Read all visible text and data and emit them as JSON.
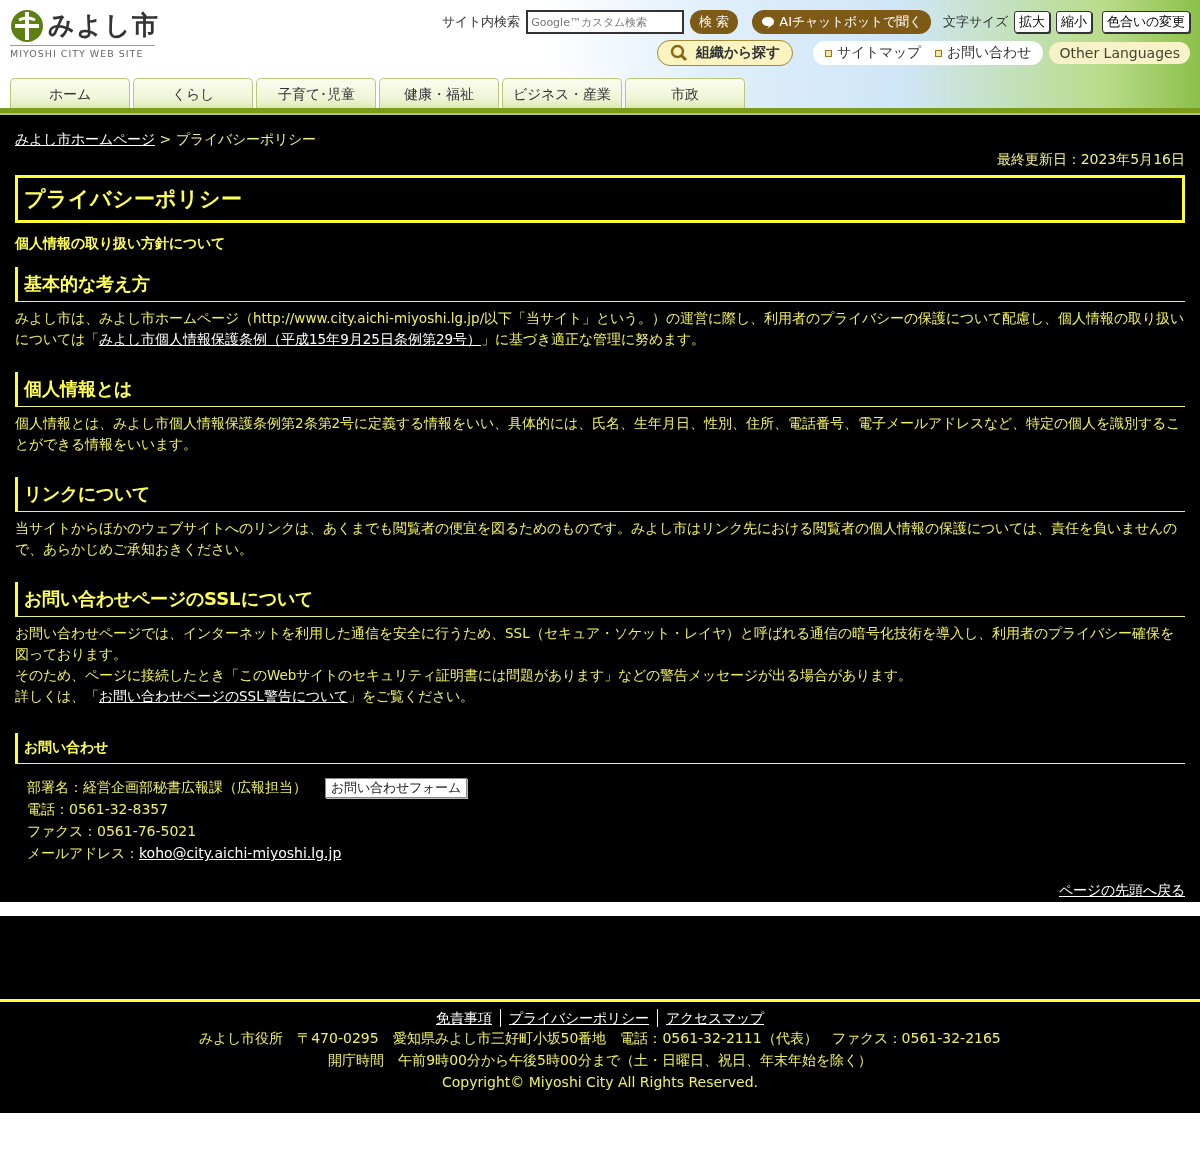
{
  "header": {
    "logo_text": "みよし市",
    "logo_subtext": "MIYOSHI CITY WEB SITE",
    "search_label": "サイト内検索",
    "search": {
      "placeholder": "Google™カスタム検索"
    },
    "search_button": "検 索",
    "chatbot_button": "AIチャットボットで聞く",
    "font_size_label": "文字サイズ",
    "font_buttons": [
      "拡大",
      "縮小"
    ],
    "color_button": "色合いの変更",
    "org_search_button": "組織から探す",
    "links": [
      "サイトマップ",
      "お問い合わせ"
    ],
    "languages_button": "Other Languages"
  },
  "nav_tabs": [
    "ホーム",
    "くらし",
    "子育て･児童",
    "健康・福祉",
    "ビジネス・産業",
    "市政"
  ],
  "breadcrumb": {
    "home": "みよし市ホームページ",
    "separator": ">",
    "current": "プライバシーポリシー"
  },
  "updated": "最終更新日：2023年5月16日",
  "title": "プライバシーポリシー",
  "subtitle": "個人情報の取り扱い方針について",
  "sections": [
    {
      "heading": "基本的な考え方",
      "lines": [
        [
          {
            "kind": "text",
            "text": "みよし市は、みよし市ホームページ（http://www.city.aichi-miyoshi.lg.jp/以下「当サイト」という。）の運営に際し、利用者のプライバシーの保護について配慮し、個人情報の取り扱いについては「"
          },
          {
            "kind": "link",
            "text": "みよし市個人情報保護条例（平成15年9月25日条例第29号）"
          },
          {
            "kind": "text",
            "text": "」に基づき適正な管理に努めます。"
          }
        ]
      ]
    },
    {
      "heading": "個人情報とは",
      "lines": [
        [
          {
            "kind": "text",
            "text": "個人情報とは、みよし市個人情報保護条例第2条第2号に定義する情報をいい、具体的には、氏名、生年月日、性別、住所、電話番号、電子メールアドレスなど、特定の個人を識別することができる情報をいいます。"
          }
        ]
      ]
    },
    {
      "heading": "リンクについて",
      "lines": [
        [
          {
            "kind": "text",
            "text": "当サイトからほかのウェブサイトへのリンクは、あくまでも閲覧者の便宜を図るためのものです。みよし市はリンク先における閲覧者の個人情報の保護については、責任を負いませんので、あらかじめご承知おきください。"
          }
        ]
      ]
    },
    {
      "heading": "お問い合わせページのSSLについて",
      "lines": [
        [
          {
            "kind": "text",
            "text": "お問い合わせページでは、インターネットを利用した通信を安全に行うため、SSL（セキュア・ソケット・レイヤ）と呼ばれる通信の暗号化技術を導入し、利用者のプライバシー確保を図っております。"
          }
        ],
        [
          {
            "kind": "text",
            "text": "そのため、ページに接続したとき「このWebサイトのセキュリティ証明書には問題があります」などの警告メッセージが出る場合があります。"
          }
        ],
        [
          {
            "kind": "text",
            "text": "詳しくは、「"
          },
          {
            "kind": "link",
            "text": "お問い合わせページのSSL警告について"
          },
          {
            "kind": "text",
            "text": "」をご覧ください。"
          }
        ]
      ]
    }
  ],
  "contact": {
    "heading": "お問い合わせ",
    "department": "部署名：経営企画部秘書広報課（広報担当）",
    "form_button": "お問い合わせフォーム",
    "phone": "電話：0561-32-8357",
    "fax": "ファクス：0561-76-5021",
    "email_label": "メールアドレス：",
    "email": "koho@city.aichi-miyoshi.lg.jp"
  },
  "back_to_top": "ページの先頭へ戻る",
  "footer": {
    "links": [
      "免責事項",
      "プライバシーポリシー",
      "アクセスマップ"
    ],
    "address": "みよし市役所　〒470-0295　愛知県みよし市三好町小坂50番地　電話：0561-32-2111（代表）　ファクス：0561-32-2165",
    "hours": "開庁時間　午前9時00分から午後5時00分まで（土・日曜日、祝日、年末年始を除く）",
    "copyright": "Copyright© Miyoshi City All Rights Reserved."
  }
}
